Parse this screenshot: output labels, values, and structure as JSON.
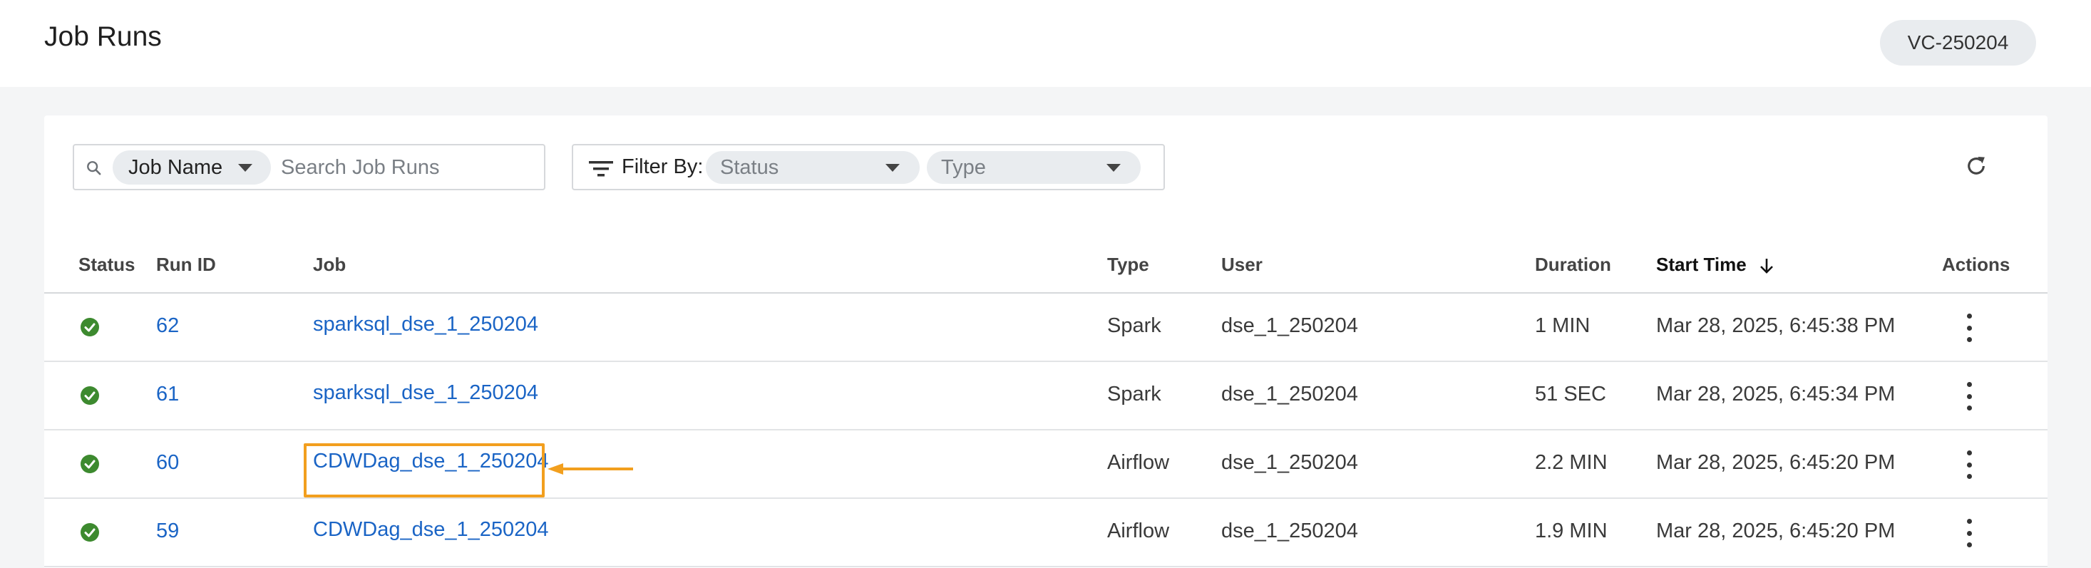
{
  "header": {
    "title": "Job Runs",
    "vc_label": "VC-250204"
  },
  "toolbar": {
    "search_field_label": "Job Name",
    "search_placeholder": "Search Job Runs",
    "filter_label": "Filter By:",
    "status_placeholder": "Status",
    "type_placeholder": "Type"
  },
  "table": {
    "columns": {
      "status": "Status",
      "run_id": "Run ID",
      "job": "Job",
      "type": "Type",
      "user": "User",
      "duration": "Duration",
      "start_time": "Start Time",
      "actions": "Actions"
    },
    "sorted_column": "start_time",
    "sort_direction": "descending",
    "rows": [
      {
        "status": "succeeded",
        "run_id": "62",
        "job": "sparksql_dse_1_250204",
        "type": "Spark",
        "user": "dse_1_250204",
        "duration": "1 MIN",
        "start_time": "Mar 28, 2025, 6:45:38 PM"
      },
      {
        "status": "succeeded",
        "run_id": "61",
        "job": "sparksql_dse_1_250204",
        "type": "Spark",
        "user": "dse_1_250204",
        "duration": "51 SEC",
        "start_time": "Mar 28, 2025, 6:45:34 PM"
      },
      {
        "status": "succeeded",
        "run_id": "60",
        "job": "CDWDag_dse_1_250204",
        "type": "Airflow",
        "user": "dse_1_250204",
        "duration": "2.2 MIN",
        "start_time": "Mar 28, 2025, 6:45:20 PM"
      },
      {
        "status": "succeeded",
        "run_id": "59",
        "job": "CDWDag_dse_1_250204",
        "type": "Airflow",
        "user": "dse_1_250204",
        "duration": "1.9 MIN",
        "start_time": "Mar 28, 2025, 6:45:20 PM"
      }
    ]
  },
  "annotation": {
    "highlighted_row_run_id": "60",
    "color": "#f29f1e"
  },
  "colors": {
    "link": "#1a64c5",
    "success": "#3d8a2f"
  },
  "icons": {
    "search": "search-icon",
    "filter": "filter-icon",
    "refresh": "refresh-icon",
    "status_success": "check-circle-icon",
    "actions": "more-vertical-icon",
    "sort": "arrow-down-icon"
  }
}
